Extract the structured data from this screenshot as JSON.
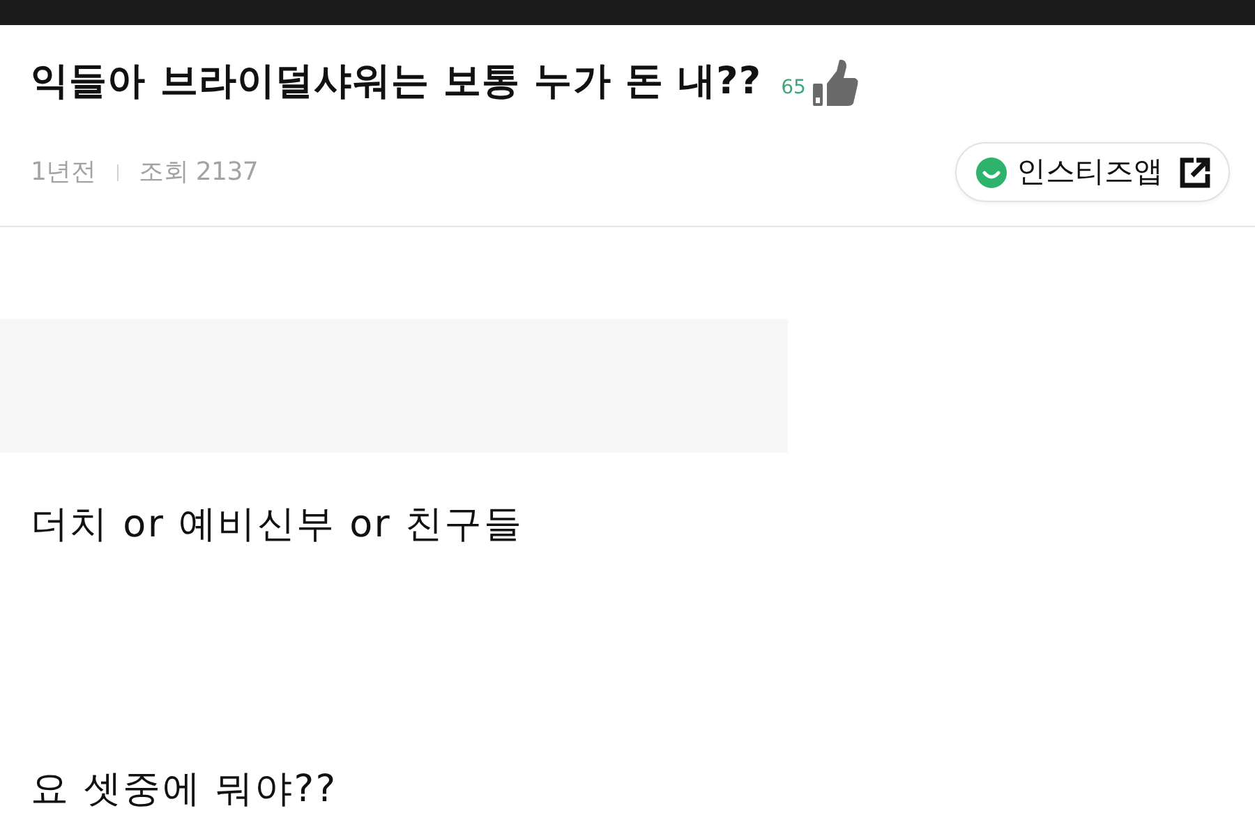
{
  "post": {
    "title": "익들아 브라이덜샤워는 보통 누가 돈 내??",
    "likes": "65",
    "time": "1년전",
    "views": "조회 2137"
  },
  "app_button": {
    "label": "인스티즈앱"
  },
  "body": {
    "lines": [
      "더치 or 예비신부 or 친구들",
      "요 셋중에 뭐야??"
    ]
  }
}
